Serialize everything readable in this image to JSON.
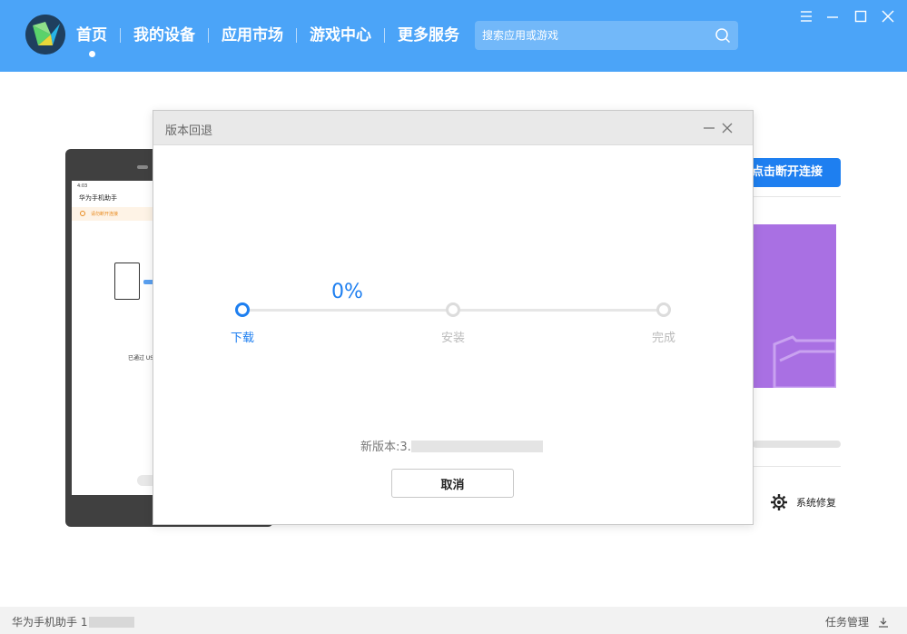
{
  "nav": {
    "items": [
      {
        "label": "首页"
      },
      {
        "label": "我的设备"
      },
      {
        "label": "应用市场"
      },
      {
        "label": "游戏中心"
      },
      {
        "label": "更多服务"
      }
    ]
  },
  "search": {
    "placeholder": "搜索应用或游戏"
  },
  "phone": {
    "status": "4:03",
    "app_title": "华为手机助手",
    "tip": "请勿断开连接",
    "usb_text": "已通过 USB"
  },
  "right_panel": {
    "disconnect_label": "点击断开连接",
    "repair_label": "系统修复"
  },
  "dialog": {
    "title": "版本回退",
    "progress": "0%",
    "steps": [
      "下载",
      "安装",
      "完成"
    ],
    "version_label": "新版本:3.",
    "cancel_label": "取消"
  },
  "status_bar": {
    "app_label": "华为手机助手 1",
    "task_label": "任务管理"
  },
  "colors": {
    "topbar": "#4ba4f8",
    "accent": "#1e7ff0",
    "promo": "#a970e3"
  }
}
